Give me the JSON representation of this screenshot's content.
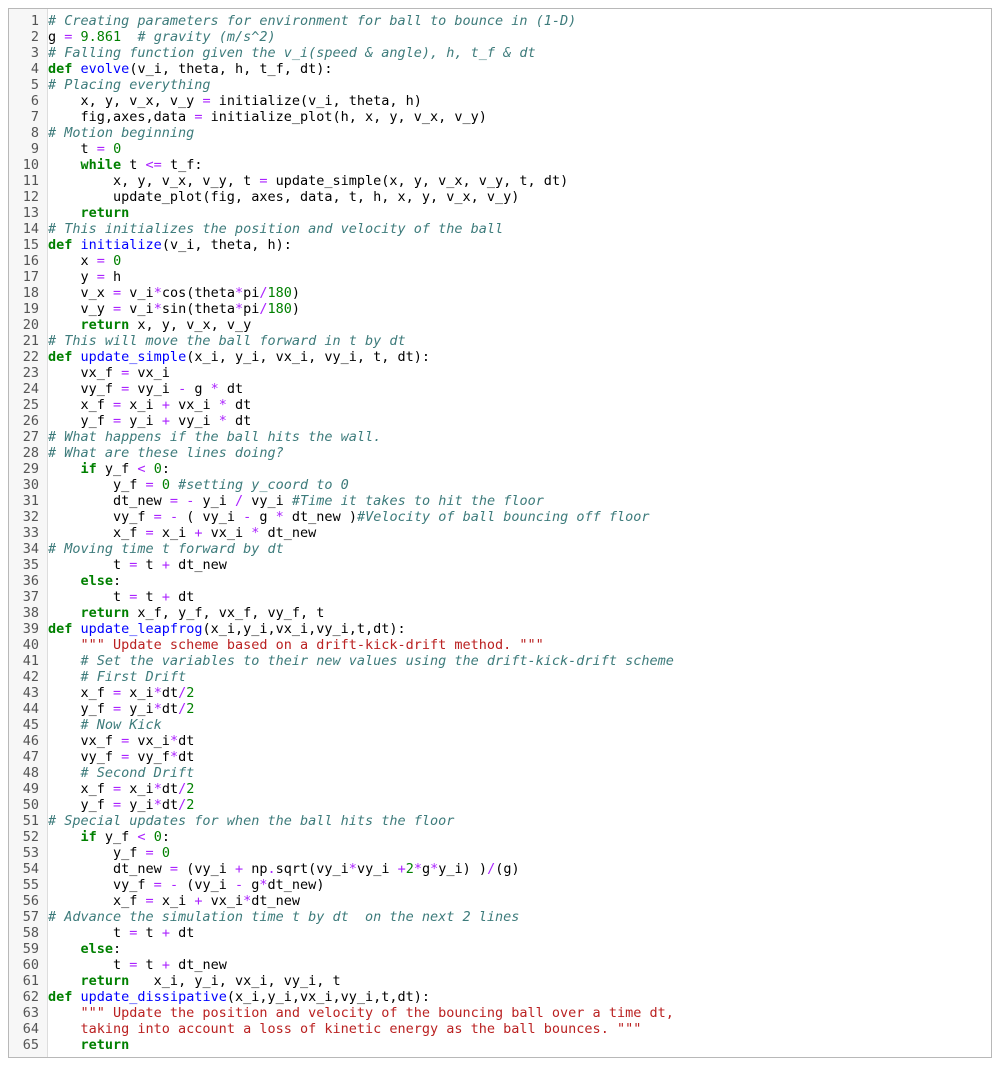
{
  "editor": {
    "lines": [
      [
        [
          "cm",
          "# Creating parameters for environment for ball to bounce in (1-D)"
        ]
      ],
      [
        [
          "n",
          "g "
        ],
        [
          "op",
          "="
        ],
        [
          "n",
          " "
        ],
        [
          "num",
          "9.861"
        ],
        [
          "n",
          "  "
        ],
        [
          "cm",
          "# gravity (m/s^2)"
        ]
      ],
      [
        [
          "cm",
          "# Falling function given the v_i(speed & angle), h, t_f & dt"
        ]
      ],
      [
        [
          "kw",
          "def"
        ],
        [
          "n",
          " "
        ],
        [
          "fn",
          "evolve"
        ],
        [
          "n",
          "(v_i, theta, h, t_f, dt):"
        ]
      ],
      [
        [
          "cm",
          "# Placing everything"
        ]
      ],
      [
        [
          "n",
          "    x, y, v_x, v_y "
        ],
        [
          "op",
          "="
        ],
        [
          "n",
          " initialize(v_i, theta, h)"
        ]
      ],
      [
        [
          "n",
          "    fig,axes,data "
        ],
        [
          "op",
          "="
        ],
        [
          "n",
          " initialize_plot(h, x, y, v_x, v_y)"
        ]
      ],
      [
        [
          "cm",
          "# Motion beginning"
        ]
      ],
      [
        [
          "n",
          "    t "
        ],
        [
          "op",
          "="
        ],
        [
          "n",
          " "
        ],
        [
          "num",
          "0"
        ]
      ],
      [
        [
          "n",
          "    "
        ],
        [
          "kw",
          "while"
        ],
        [
          "n",
          " t "
        ],
        [
          "op",
          "<="
        ],
        [
          "n",
          " t_f:"
        ]
      ],
      [
        [
          "n",
          "        x, y, v_x, v_y, t "
        ],
        [
          "op",
          "="
        ],
        [
          "n",
          " update_simple(x, y, v_x, v_y, t, dt)"
        ]
      ],
      [
        [
          "n",
          "        update_plot(fig, axes, data, t, h, x, y, v_x, v_y)"
        ]
      ],
      [
        [
          "n",
          "    "
        ],
        [
          "kw",
          "return"
        ]
      ],
      [
        [
          "cm",
          "# This initializes the position and velocity of the ball"
        ]
      ],
      [
        [
          "kw",
          "def"
        ],
        [
          "n",
          " "
        ],
        [
          "fn",
          "initialize"
        ],
        [
          "n",
          "(v_i, theta, h):"
        ]
      ],
      [
        [
          "n",
          "    x "
        ],
        [
          "op",
          "="
        ],
        [
          "n",
          " "
        ],
        [
          "num",
          "0"
        ]
      ],
      [
        [
          "n",
          "    y "
        ],
        [
          "op",
          "="
        ],
        [
          "n",
          " h"
        ]
      ],
      [
        [
          "n",
          "    v_x "
        ],
        [
          "op",
          "="
        ],
        [
          "n",
          " v_i"
        ],
        [
          "op",
          "*"
        ],
        [
          "n",
          "cos(theta"
        ],
        [
          "op",
          "*"
        ],
        [
          "n",
          "pi"
        ],
        [
          "op",
          "/"
        ],
        [
          "num",
          "180"
        ],
        [
          "n",
          ")"
        ]
      ],
      [
        [
          "n",
          "    v_y "
        ],
        [
          "op",
          "="
        ],
        [
          "n",
          " v_i"
        ],
        [
          "op",
          "*"
        ],
        [
          "n",
          "sin(theta"
        ],
        [
          "op",
          "*"
        ],
        [
          "n",
          "pi"
        ],
        [
          "op",
          "/"
        ],
        [
          "num",
          "180"
        ],
        [
          "n",
          ")"
        ]
      ],
      [
        [
          "n",
          "    "
        ],
        [
          "kw",
          "return"
        ],
        [
          "n",
          " x, y, v_x, v_y"
        ]
      ],
      [
        [
          "cm",
          "# This will move the ball forward in t by dt"
        ]
      ],
      [
        [
          "kw",
          "def"
        ],
        [
          "n",
          " "
        ],
        [
          "fn",
          "update_simple"
        ],
        [
          "n",
          "(x_i, y_i, vx_i, vy_i, t, dt):"
        ]
      ],
      [
        [
          "n",
          "    vx_f "
        ],
        [
          "op",
          "="
        ],
        [
          "n",
          " vx_i"
        ]
      ],
      [
        [
          "n",
          "    vy_f "
        ],
        [
          "op",
          "="
        ],
        [
          "n",
          " vy_i "
        ],
        [
          "op",
          "-"
        ],
        [
          "n",
          " g "
        ],
        [
          "op",
          "*"
        ],
        [
          "n",
          " dt"
        ]
      ],
      [
        [
          "n",
          "    x_f "
        ],
        [
          "op",
          "="
        ],
        [
          "n",
          " x_i "
        ],
        [
          "op",
          "+"
        ],
        [
          "n",
          " vx_i "
        ],
        [
          "op",
          "*"
        ],
        [
          "n",
          " dt"
        ]
      ],
      [
        [
          "n",
          "    y_f "
        ],
        [
          "op",
          "="
        ],
        [
          "n",
          " y_i "
        ],
        [
          "op",
          "+"
        ],
        [
          "n",
          " vy_i "
        ],
        [
          "op",
          "*"
        ],
        [
          "n",
          " dt"
        ]
      ],
      [
        [
          "cm",
          "# What happens if the ball hits the wall."
        ]
      ],
      [
        [
          "cm",
          "# What are these lines doing?"
        ]
      ],
      [
        [
          "n",
          "    "
        ],
        [
          "kw",
          "if"
        ],
        [
          "n",
          " y_f "
        ],
        [
          "op",
          "<"
        ],
        [
          "n",
          " "
        ],
        [
          "num",
          "0"
        ],
        [
          "n",
          ":"
        ]
      ],
      [
        [
          "n",
          "        y_f "
        ],
        [
          "op",
          "="
        ],
        [
          "n",
          " "
        ],
        [
          "num",
          "0"
        ],
        [
          "n",
          " "
        ],
        [
          "cm",
          "#setting y_coord to 0"
        ]
      ],
      [
        [
          "n",
          "        dt_new "
        ],
        [
          "op",
          "="
        ],
        [
          "n",
          " "
        ],
        [
          "op",
          "-"
        ],
        [
          "n",
          " y_i "
        ],
        [
          "op",
          "/"
        ],
        [
          "n",
          " vy_i "
        ],
        [
          "cm",
          "#Time it takes to hit the floor"
        ]
      ],
      [
        [
          "n",
          "        vy_f "
        ],
        [
          "op",
          "="
        ],
        [
          "n",
          " "
        ],
        [
          "op",
          "-"
        ],
        [
          "n",
          " ( vy_i "
        ],
        [
          "op",
          "-"
        ],
        [
          "n",
          " g "
        ],
        [
          "op",
          "*"
        ],
        [
          "n",
          " dt_new )"
        ],
        [
          "cm",
          "#Velocity of ball bouncing off floor"
        ]
      ],
      [
        [
          "n",
          "        x_f "
        ],
        [
          "op",
          "="
        ],
        [
          "n",
          " x_i "
        ],
        [
          "op",
          "+"
        ],
        [
          "n",
          " vx_i "
        ],
        [
          "op",
          "*"
        ],
        [
          "n",
          " dt_new"
        ]
      ],
      [
        [
          "cm",
          "# Moving time t forward by dt"
        ]
      ],
      [
        [
          "n",
          "        t "
        ],
        [
          "op",
          "="
        ],
        [
          "n",
          " t "
        ],
        [
          "op",
          "+"
        ],
        [
          "n",
          " dt_new"
        ]
      ],
      [
        [
          "n",
          "    "
        ],
        [
          "kw",
          "else"
        ],
        [
          "n",
          ":"
        ]
      ],
      [
        [
          "n",
          "        t "
        ],
        [
          "op",
          "="
        ],
        [
          "n",
          " t "
        ],
        [
          "op",
          "+"
        ],
        [
          "n",
          " dt"
        ]
      ],
      [
        [
          "n",
          "    "
        ],
        [
          "kw",
          "return"
        ],
        [
          "n",
          " x_f, y_f, vx_f, vy_f, t"
        ]
      ],
      [
        [
          "kw",
          "def"
        ],
        [
          "n",
          " "
        ],
        [
          "fn",
          "update_leapfrog"
        ],
        [
          "n",
          "(x_i,y_i,vx_i,vy_i,t,dt):"
        ]
      ],
      [
        [
          "n",
          "    "
        ],
        [
          "str",
          "\"\"\" Update scheme based on a drift-kick-drift method. \"\"\""
        ]
      ],
      [
        [
          "n",
          "    "
        ],
        [
          "cm",
          "# Set the variables to their new values using the drift-kick-drift scheme"
        ]
      ],
      [
        [
          "n",
          "    "
        ],
        [
          "cm",
          "# First Drift"
        ]
      ],
      [
        [
          "n",
          "    x_f "
        ],
        [
          "op",
          "="
        ],
        [
          "n",
          " x_i"
        ],
        [
          "op",
          "*"
        ],
        [
          "n",
          "dt"
        ],
        [
          "op",
          "/"
        ],
        [
          "num",
          "2"
        ]
      ],
      [
        [
          "n",
          "    y_f "
        ],
        [
          "op",
          "="
        ],
        [
          "n",
          " y_i"
        ],
        [
          "op",
          "*"
        ],
        [
          "n",
          "dt"
        ],
        [
          "op",
          "/"
        ],
        [
          "num",
          "2"
        ]
      ],
      [
        [
          "n",
          "    "
        ],
        [
          "cm",
          "# Now Kick"
        ]
      ],
      [
        [
          "n",
          "    vx_f "
        ],
        [
          "op",
          "="
        ],
        [
          "n",
          " vx_i"
        ],
        [
          "op",
          "*"
        ],
        [
          "n",
          "dt"
        ]
      ],
      [
        [
          "n",
          "    vy_f "
        ],
        [
          "op",
          "="
        ],
        [
          "n",
          " vy_f"
        ],
        [
          "op",
          "*"
        ],
        [
          "n",
          "dt"
        ]
      ],
      [
        [
          "n",
          "    "
        ],
        [
          "cm",
          "# Second Drift"
        ]
      ],
      [
        [
          "n",
          "    x_f "
        ],
        [
          "op",
          "="
        ],
        [
          "n",
          " x_i"
        ],
        [
          "op",
          "*"
        ],
        [
          "n",
          "dt"
        ],
        [
          "op",
          "/"
        ],
        [
          "num",
          "2"
        ]
      ],
      [
        [
          "n",
          "    y_f "
        ],
        [
          "op",
          "="
        ],
        [
          "n",
          " y_i"
        ],
        [
          "op",
          "*"
        ],
        [
          "n",
          "dt"
        ],
        [
          "op",
          "/"
        ],
        [
          "num",
          "2"
        ]
      ],
      [
        [
          "cm",
          "# Special updates for when the ball hits the floor"
        ]
      ],
      [
        [
          "n",
          "    "
        ],
        [
          "kw",
          "if"
        ],
        [
          "n",
          " y_f "
        ],
        [
          "op",
          "<"
        ],
        [
          "n",
          " "
        ],
        [
          "num",
          "0"
        ],
        [
          "n",
          ":"
        ]
      ],
      [
        [
          "n",
          "        y_f "
        ],
        [
          "op",
          "="
        ],
        [
          "n",
          " "
        ],
        [
          "num",
          "0"
        ]
      ],
      [
        [
          "n",
          "        dt_new "
        ],
        [
          "op",
          "="
        ],
        [
          "n",
          " (vy_i "
        ],
        [
          "op",
          "+"
        ],
        [
          "n",
          " np"
        ],
        [
          "op",
          "."
        ],
        [
          "n",
          "sqrt(vy_i"
        ],
        [
          "op",
          "*"
        ],
        [
          "n",
          "vy_i "
        ],
        [
          "op",
          "+"
        ],
        [
          "num",
          "2"
        ],
        [
          "op",
          "*"
        ],
        [
          "n",
          "g"
        ],
        [
          "op",
          "*"
        ],
        [
          "n",
          "y_i) )"
        ],
        [
          "op",
          "/"
        ],
        [
          "n",
          "(g)"
        ]
      ],
      [
        [
          "n",
          "        vy_f "
        ],
        [
          "op",
          "="
        ],
        [
          "n",
          " "
        ],
        [
          "op",
          "-"
        ],
        [
          "n",
          " (vy_i "
        ],
        [
          "op",
          "-"
        ],
        [
          "n",
          " g"
        ],
        [
          "op",
          "*"
        ],
        [
          "n",
          "dt_new)"
        ]
      ],
      [
        [
          "n",
          "        x_f "
        ],
        [
          "op",
          "="
        ],
        [
          "n",
          " x_i "
        ],
        [
          "op",
          "+"
        ],
        [
          "n",
          " vx_i"
        ],
        [
          "op",
          "*"
        ],
        [
          "n",
          "dt_new"
        ]
      ],
      [
        [
          "cm",
          "# Advance the simulation time t by dt  on the next 2 lines"
        ]
      ],
      [
        [
          "n",
          "        t "
        ],
        [
          "op",
          "="
        ],
        [
          "n",
          " t "
        ],
        [
          "op",
          "+"
        ],
        [
          "n",
          " dt"
        ]
      ],
      [
        [
          "n",
          "    "
        ],
        [
          "kw",
          "else"
        ],
        [
          "n",
          ":"
        ]
      ],
      [
        [
          "n",
          "        t "
        ],
        [
          "op",
          "="
        ],
        [
          "n",
          " t "
        ],
        [
          "op",
          "+"
        ],
        [
          "n",
          " dt_new"
        ]
      ],
      [
        [
          "n",
          "    "
        ],
        [
          "kw",
          "return"
        ],
        [
          "n",
          "   x_i, y_i, vx_i, vy_i, t"
        ]
      ],
      [
        [
          "kw",
          "def"
        ],
        [
          "n",
          " "
        ],
        [
          "fn",
          "update_dissipative"
        ],
        [
          "n",
          "(x_i,y_i,vx_i,vy_i,t,dt):"
        ]
      ],
      [
        [
          "n",
          "    "
        ],
        [
          "str",
          "\"\"\" Update the position and velocity of the bouncing ball over a time dt,"
        ]
      ],
      [
        [
          "n",
          "    "
        ],
        [
          "str",
          "taking into account a loss of kinetic energy as the ball bounces. \"\"\""
        ]
      ],
      [
        [
          "n",
          "    "
        ],
        [
          "kw",
          "return"
        ]
      ]
    ]
  }
}
